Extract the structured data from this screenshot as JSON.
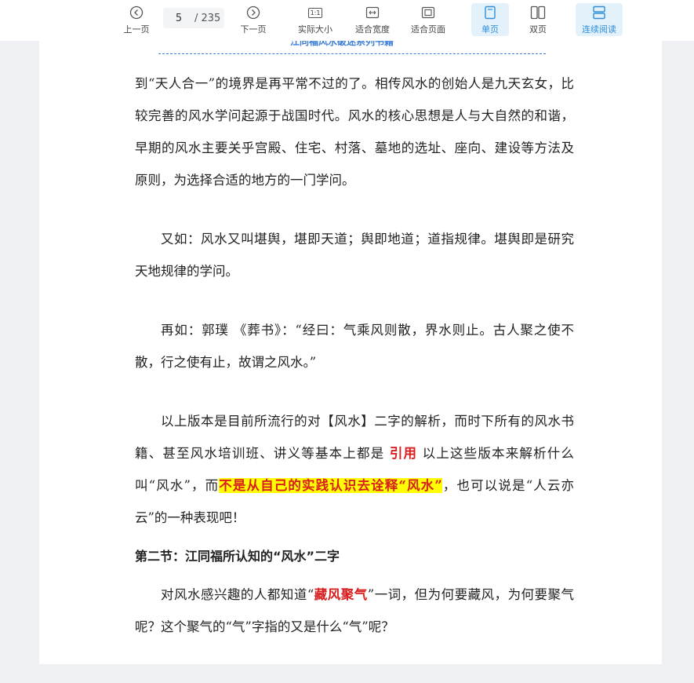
{
  "toolbar": {
    "prev_label": "上一页",
    "next_label": "下一页",
    "current_page": "5",
    "total_pages": "/ 235",
    "actual_size_label": "实际大小",
    "actual_size_icon_text": "1:1",
    "fit_width_label": "适合宽度",
    "fit_page_label": "适合页面",
    "single_page_label": "单页",
    "double_page_label": "双页",
    "continuous_label": "连续阅读",
    "active_color": "#2f8fd8"
  },
  "document": {
    "header_text": "江同福风水破迷系列书籍",
    "para1": "到“天人合一”的境界是再平常不过的了。相传风水的创始人是九天玄女，比较完善的风水学问起源于战国时代。风水的核心思想是人与大自然的和谐，早期的风水主要关乎宫殿、住宅、村落、墓地的选址、座向、建设等方法及原则，为选择合适的地方的一门学问。",
    "para2": "又如：风水又叫堪舆，堪即天道；舆即地道；道指规律。堪舆即是研究天地规律的学问。",
    "para3": "再如：郭璞 《葬书》：“经曰：气乘风则散，界水则止。古人聚之使不散，行之使有止，故谓之风水。”",
    "para4_a": "以上版本是目前所流行的对【风水】二字的解析，而时下所有的风水书籍、甚至风水培训班、讲义等基本上都是 ",
    "para4_red": "引用",
    "para4_b": " 以上这些版本来解析什么叫“风水”，而",
    "para4_hl": "不是从自己的实践认识去诠释“风水”",
    "para4_c": "，也可以说是“人云亦云”的一种表现吧！",
    "heading": "第二节：江同福所认知的“风水”二字",
    "para5_a": "对风水感兴趣的人都知道“",
    "para5_red": "藏风聚气",
    "para5_b": "”一词，但为何要藏风，为何要聚气呢？这个聚气的“气”字指的又是什么“气”呢？"
  }
}
